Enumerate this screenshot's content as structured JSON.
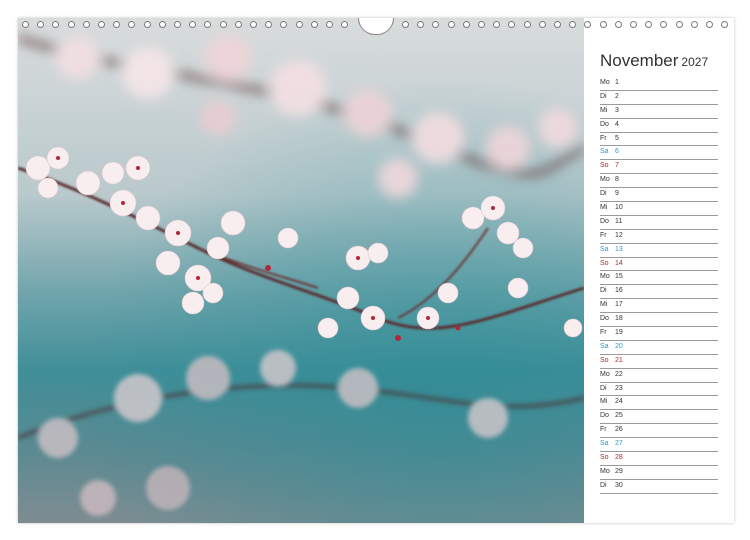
{
  "calendar": {
    "month": "November",
    "year": "2027",
    "days": [
      {
        "wd": "Mo",
        "num": "1",
        "type": "weekday"
      },
      {
        "wd": "Di",
        "num": "2",
        "type": "weekday"
      },
      {
        "wd": "Mi",
        "num": "3",
        "type": "weekday"
      },
      {
        "wd": "Do",
        "num": "4",
        "type": "weekday"
      },
      {
        "wd": "Fr",
        "num": "5",
        "type": "weekday"
      },
      {
        "wd": "Sa",
        "num": "6",
        "type": "sat"
      },
      {
        "wd": "So",
        "num": "7",
        "type": "sun"
      },
      {
        "wd": "Mo",
        "num": "8",
        "type": "weekday"
      },
      {
        "wd": "Di",
        "num": "9",
        "type": "weekday"
      },
      {
        "wd": "Mi",
        "num": "10",
        "type": "weekday"
      },
      {
        "wd": "Do",
        "num": "11",
        "type": "weekday"
      },
      {
        "wd": "Fr",
        "num": "12",
        "type": "weekday"
      },
      {
        "wd": "Sa",
        "num": "13",
        "type": "sat"
      },
      {
        "wd": "So",
        "num": "14",
        "type": "sun"
      },
      {
        "wd": "Mo",
        "num": "15",
        "type": "weekday"
      },
      {
        "wd": "Di",
        "num": "16",
        "type": "weekday"
      },
      {
        "wd": "Mi",
        "num": "17",
        "type": "weekday"
      },
      {
        "wd": "Do",
        "num": "18",
        "type": "weekday"
      },
      {
        "wd": "Fr",
        "num": "19",
        "type": "weekday"
      },
      {
        "wd": "Sa",
        "num": "20",
        "type": "sat"
      },
      {
        "wd": "So",
        "num": "21",
        "type": "sun"
      },
      {
        "wd": "Mo",
        "num": "22",
        "type": "weekday"
      },
      {
        "wd": "Di",
        "num": "23",
        "type": "weekday"
      },
      {
        "wd": "Mi",
        "num": "24",
        "type": "weekday"
      },
      {
        "wd": "Do",
        "num": "25",
        "type": "weekday"
      },
      {
        "wd": "Fr",
        "num": "26",
        "type": "weekday"
      },
      {
        "wd": "Sa",
        "num": "27",
        "type": "sat"
      },
      {
        "wd": "So",
        "num": "28",
        "type": "sun"
      },
      {
        "wd": "Mo",
        "num": "29",
        "type": "weekday"
      },
      {
        "wd": "Di",
        "num": "30",
        "type": "weekday"
      }
    ]
  },
  "colors": {
    "saturday": "#2a9bd0",
    "sunday": "#b0282e",
    "rule": "#9a9a9a"
  },
  "photo": {
    "subject": "cherry-blossom-branches-over-water"
  }
}
